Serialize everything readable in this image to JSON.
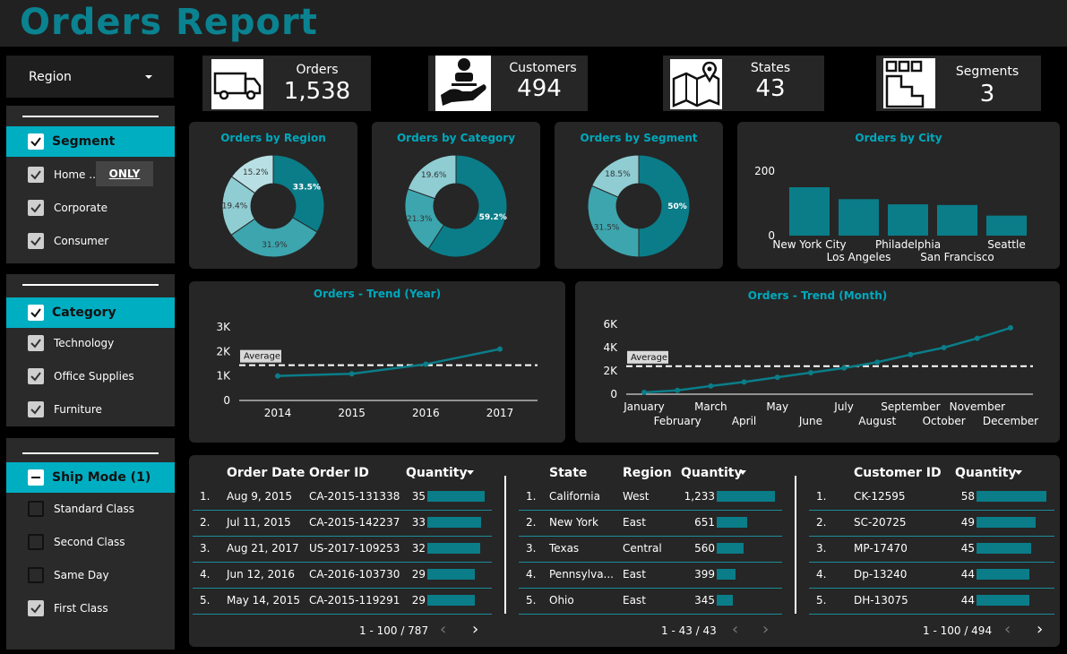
{
  "title": "Orders Report",
  "sidebar": {
    "region_dropdown": "Region",
    "segment": {
      "header": "Segment",
      "items": [
        "Home ...",
        "Corporate",
        "Consumer"
      ],
      "only_label": "ONLY"
    },
    "category": {
      "header": "Category",
      "items": [
        "Technology",
        "Office Supplies",
        "Furniture"
      ]
    },
    "ship_mode": {
      "header": "Ship Mode (1)",
      "items": [
        "Standard Class",
        "Second Class",
        "Same Day",
        "First Class"
      ]
    }
  },
  "kpis": [
    {
      "label": "Orders",
      "value": "1,538",
      "icon": "van-icon"
    },
    {
      "label": "Customers",
      "value": "494",
      "icon": "customer-icon"
    },
    {
      "label": "States",
      "value": "43",
      "icon": "map-icon"
    },
    {
      "label": "Segments",
      "value": "3",
      "icon": "segments-icon"
    }
  ],
  "colors": {
    "accent": "#00aec2",
    "title": "#0a8290",
    "bar": "#0a7d89",
    "donut_dark": "#0a7d89",
    "donut_mid": "#3da5ae",
    "donut_light": "#8fcdd3",
    "donut_lightest": "#b8e0e4"
  },
  "chart_data": [
    {
      "type": "pie",
      "title": "Orders by Region",
      "slices": [
        {
          "value": 33.5,
          "label": "33.5%"
        },
        {
          "value": 31.9,
          "label": "31.9%"
        },
        {
          "value": 19.4,
          "label": "19.4%"
        },
        {
          "value": 15.2,
          "label": "15.2%"
        }
      ]
    },
    {
      "type": "pie",
      "title": "Orders by Category",
      "slices": [
        {
          "value": 59.2,
          "label": "59.2%"
        },
        {
          "value": 21.3,
          "label": "21.3%"
        },
        {
          "value": 19.6,
          "label": "19.6%"
        }
      ]
    },
    {
      "type": "pie",
      "title": "Orders by Segment",
      "slices": [
        {
          "value": 50,
          "label": "50%"
        },
        {
          "value": 31.5,
          "label": "31.5%"
        },
        {
          "value": 18.5,
          "label": "18.5%"
        }
      ]
    },
    {
      "type": "bar",
      "title": "Orders by City",
      "categories": [
        "New York City",
        "Los Angeles",
        "Philadelphia",
        "San Francisco",
        "Seattle"
      ],
      "values": [
        150,
        113,
        97,
        95,
        62
      ],
      "yticks": [
        "0",
        "200"
      ],
      "ylim": [
        0,
        200
      ]
    },
    {
      "type": "line",
      "title": "Orders - Trend (Year)",
      "x": [
        "2014",
        "2015",
        "2016",
        "2017"
      ],
      "values": [
        1000,
        1090,
        1480,
        2100
      ],
      "average": 1440,
      "average_label": "Average",
      "yticks": [
        "0",
        "1K",
        "2K",
        "3K"
      ],
      "ylim": [
        0,
        3000
      ]
    },
    {
      "type": "line",
      "title": "Orders - Trend (Month)",
      "x": [
        "January",
        "February",
        "March",
        "April",
        "May",
        "June",
        "July",
        "August",
        "September",
        "October",
        "November",
        "December"
      ],
      "values": [
        150,
        330,
        700,
        1050,
        1450,
        1850,
        2250,
        2750,
        3400,
        4000,
        4800,
        5700
      ],
      "average": 2400,
      "average_label": "Average",
      "yticks": [
        "0",
        "2K",
        "4K",
        "6K"
      ],
      "ylim": [
        0,
        6000
      ]
    }
  ],
  "tables": {
    "orders": {
      "headers": [
        "Order Date",
        "Order ID",
        "Quantity"
      ],
      "rows": [
        [
          "1.",
          "Aug 9, 2015",
          "CA-2015-131338",
          "35"
        ],
        [
          "2.",
          "Jul 11, 2015",
          "CA-2015-142237",
          "33"
        ],
        [
          "3.",
          "Aug 21, 2017",
          "US-2017-109253",
          "32"
        ],
        [
          "4.",
          "Jun 12, 2016",
          "CA-2016-103730",
          "29"
        ],
        [
          "5.",
          "May 14, 2015",
          "CA-2015-119291",
          "29"
        ]
      ],
      "quantities": [
        35,
        33,
        32,
        29,
        29
      ],
      "max": 35,
      "pager": "1 - 100 / 787"
    },
    "states": {
      "headers": [
        "State",
        "Region",
        "Quantity"
      ],
      "rows": [
        [
          "1.",
          "California",
          "West",
          "1,233"
        ],
        [
          "2.",
          "New York",
          "East",
          "651"
        ],
        [
          "3.",
          "Texas",
          "Central",
          "560"
        ],
        [
          "4.",
          "Pennsylva...",
          "East",
          "399"
        ],
        [
          "5.",
          "Ohio",
          "East",
          "345"
        ]
      ],
      "quantities": [
        1233,
        651,
        560,
        399,
        345
      ],
      "max": 1233,
      "pager": "1 - 43 / 43"
    },
    "customers": {
      "headers": [
        "Customer ID",
        "Quantity"
      ],
      "rows": [
        [
          "1.",
          "CK-12595",
          "58"
        ],
        [
          "2.",
          "SC-20725",
          "49"
        ],
        [
          "3.",
          "MP-17470",
          "45"
        ],
        [
          "4.",
          "Dp-13240",
          "44"
        ],
        [
          "5.",
          "DH-13075",
          "44"
        ]
      ],
      "quantities": [
        58,
        49,
        45,
        44,
        44
      ],
      "max": 58,
      "pager": "1 - 100 / 494"
    }
  }
}
